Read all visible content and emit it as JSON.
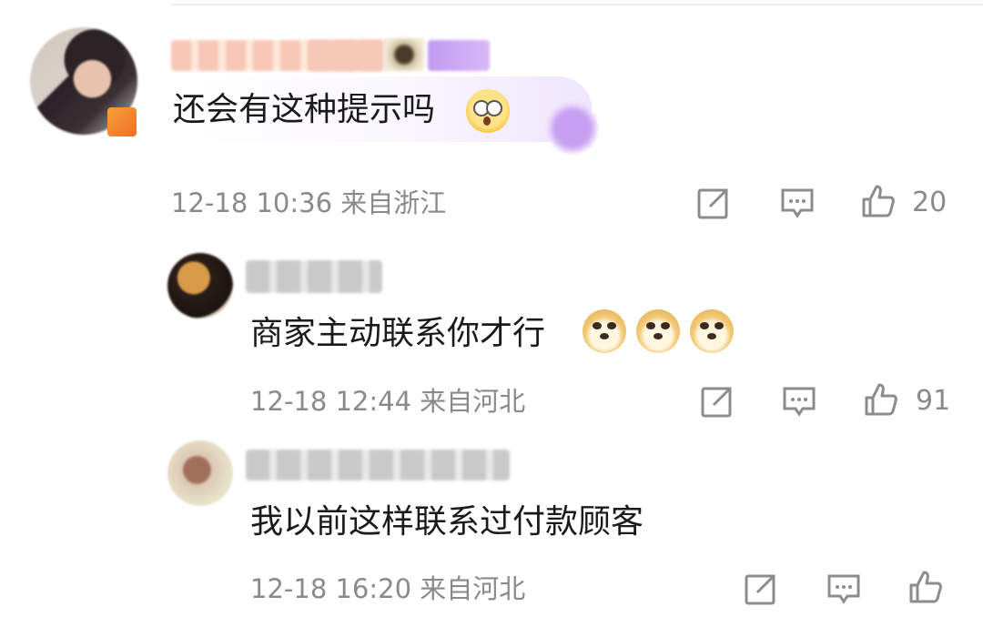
{
  "comments": [
    {
      "text": "还会有这种提示吗",
      "meta": "12-18 10:36 来自浙江",
      "like_count": "20",
      "icons": [
        "share-icon",
        "reply-icon",
        "thumbs-up-icon"
      ],
      "emoji": "flushed-face-emoji"
    },
    {
      "text": "商家主动联系你才行",
      "meta": "12-18 12:44 来自河北",
      "like_count": "91",
      "icons": [
        "share-icon",
        "reply-icon",
        "thumbs-up-icon"
      ],
      "emoji": "doge-emoji"
    },
    {
      "text": "我以前这样联系过付款顾客",
      "meta": "12-18 16:20 来自河北",
      "like_count": "",
      "icons": [
        "share-icon",
        "reply-icon",
        "thumbs-up-icon"
      ]
    }
  ],
  "colors": {
    "text": "#1a1a1a",
    "meta": "#8a8a8a",
    "icon": "#8c8c8c"
  }
}
